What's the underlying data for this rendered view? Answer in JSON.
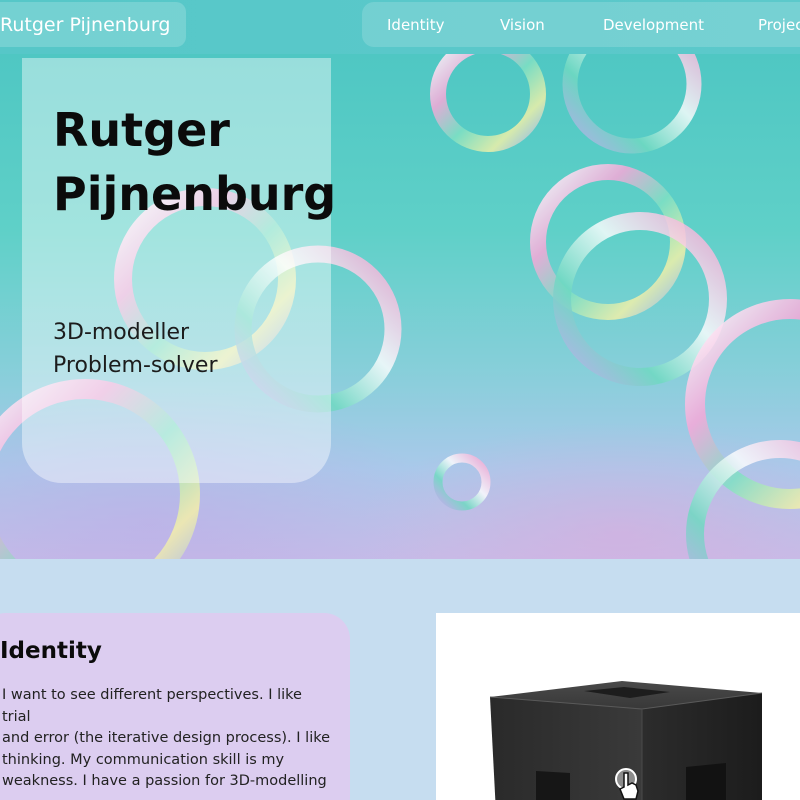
{
  "nav": {
    "brand": "Rutger Pijnenburg",
    "links": [
      {
        "label": "Identity"
      },
      {
        "label": "Vision"
      },
      {
        "label": "Development"
      },
      {
        "label": "Projects"
      }
    ]
  },
  "hero": {
    "name_line1": "Rutger",
    "name_line2": "Pijnenburg",
    "role1": "3D-modeller",
    "role2": "Problem-solver"
  },
  "identity": {
    "title": "Identity",
    "lines": [
      "I want to see different perspectives. I like trial",
      "and error (the iterative design process). I like",
      "thinking. My communication skill is my",
      "weakness. I have a passion for 3D-modelling"
    ]
  },
  "model_viewer": {
    "icon": "hand-pointer-icon"
  },
  "colors": {
    "nav_bg": "#56c7c8",
    "page_bg": "#c6ddf0",
    "identity_card_bg": "#dccdf0"
  }
}
